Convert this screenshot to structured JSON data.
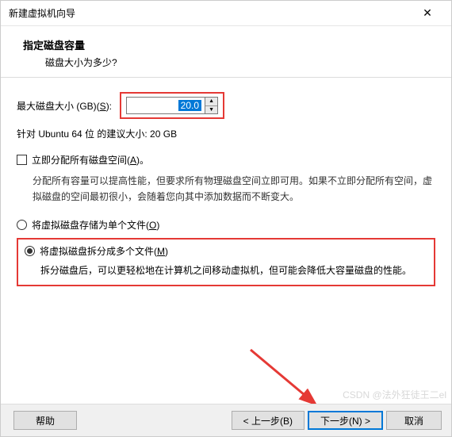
{
  "window": {
    "title": "新建虚拟机向导",
    "close_icon": "✕"
  },
  "header": {
    "title": "指定磁盘容量",
    "sub": "磁盘大小为多少?"
  },
  "disk": {
    "max_label": "最大磁盘大小 (GB)(",
    "max_key": "S",
    "max_label_tail": "):",
    "value": "20.0",
    "recommended": "针对 Ubuntu 64 位 的建议大小: 20 GB"
  },
  "allocate": {
    "label_pre": "立即分配所有磁盘空间(",
    "key": "A",
    "label_tail": ")。",
    "desc": "分配所有容量可以提高性能，但要求所有物理磁盘空间立即可用。如果不立即分配所有空间，虚拟磁盘的空间最初很小，会随着您向其中添加数据而不断变大。"
  },
  "storage": {
    "single_pre": "将虚拟磁盘存储为单个文件(",
    "single_key": "O",
    "single_tail": ")",
    "split_pre": "将虚拟磁盘拆分成多个文件(",
    "split_key": "M",
    "split_tail": ")",
    "split_desc": "拆分磁盘后，可以更轻松地在计算机之间移动虚拟机，但可能会降低大容量磁盘的性能。"
  },
  "footer": {
    "help": "帮助",
    "back": "< 上一步(B)",
    "next": "下一步(N) >",
    "cancel": "取消"
  },
  "watermark": "CSDN @法外狂徒王二el"
}
